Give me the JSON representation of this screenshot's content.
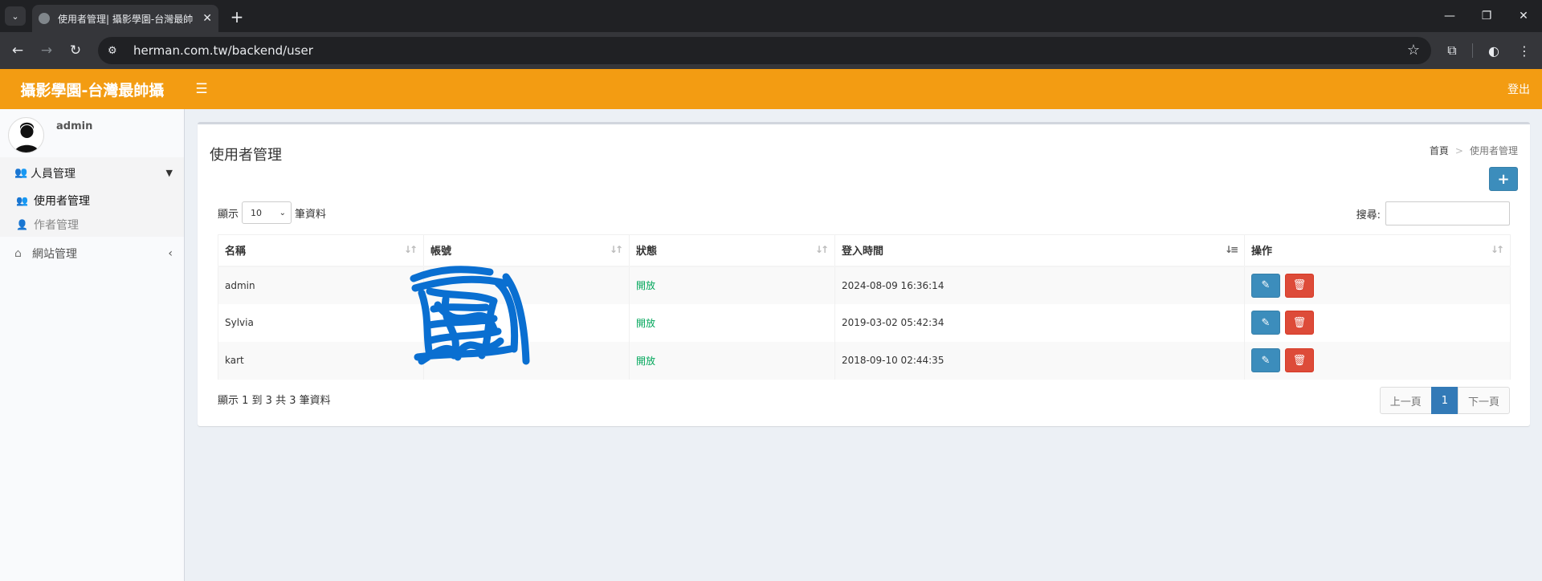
{
  "browser": {
    "tab_title": "使用者管理| 攝影學園-台灣最帥",
    "url": "herman.com.tw/backend/user",
    "new_tab": "+",
    "tab_close": "✕"
  },
  "header": {
    "logo": "攝影學園-台灣最帥攝",
    "logout": "登出",
    "accent_color": "#f39c12"
  },
  "sidebar": {
    "username": "admin",
    "section": {
      "label": "人員管理",
      "icon": "users-icon"
    },
    "items": [
      {
        "label": "使用者管理",
        "icon": "users-icon",
        "active": true
      },
      {
        "label": "作者管理",
        "icon": "user-edit-icon",
        "active": false
      }
    ],
    "site": {
      "label": "網站管理",
      "icon": "home-icon"
    }
  },
  "content": {
    "title": "使用者管理",
    "breadcrumb": {
      "home": "首頁",
      "separator": ">",
      "current": "使用者管理"
    },
    "add_button": "+",
    "length_prefix": "顯示",
    "length_value": "10",
    "length_suffix": "筆資料",
    "search_label": "搜尋:",
    "search_value": "",
    "columns": [
      "名稱",
      "帳號",
      "狀態",
      "登入時間",
      "操作"
    ],
    "rows": [
      {
        "name": "admin",
        "account": "",
        "status": "開放",
        "login_time": "2024-08-09 16:36:14"
      },
      {
        "name": "Sylvia",
        "account": "",
        "status": "開放",
        "login_time": "2019-03-02 05:42:34"
      },
      {
        "name": "kart",
        "account": "",
        "status": "開放",
        "login_time": "2018-09-10 02:44:35"
      }
    ],
    "info": "顯示 1 到 3 共 3 筆資料",
    "pagination": {
      "prev": "上一頁",
      "current": "1",
      "next": "下一頁"
    }
  }
}
